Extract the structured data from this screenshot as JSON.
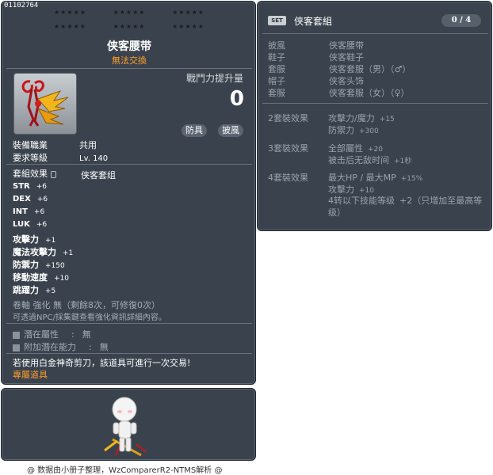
{
  "item": {
    "id": "01102764",
    "star_groups": [
      "★★★★★",
      "★★★★★",
      "★★★★★",
      "★★★★★",
      "★★★★★",
      "★★★★★"
    ],
    "name": "侠客腰带",
    "trade_status": "無法交換",
    "battle_power_label": "戰鬥力提升量",
    "battle_power_value": "0",
    "tags": [
      "防具",
      "披風"
    ],
    "requirements": [
      {
        "label": "裝備職業",
        "value": "共用"
      },
      {
        "label": "要求等級",
        "value": "Lv. 140"
      }
    ],
    "set_effect_label": "套組效果",
    "set_effect_name": "侠客套组",
    "stats": [
      {
        "label": "STR",
        "value": "+6"
      },
      {
        "label": "DEX",
        "value": "+6"
      },
      {
        "label": "INT",
        "value": "+6"
      },
      {
        "label": "LUK",
        "value": "+6"
      },
      {
        "label": "攻擊力",
        "value": "+1"
      },
      {
        "label": "魔法攻擊力",
        "value": "+1"
      },
      {
        "label": "防禦力",
        "value": "+150"
      },
      {
        "label": "移動速度",
        "value": "+10"
      },
      {
        "label": "跳躍力",
        "value": "+5"
      }
    ],
    "scroll_info": "卷軸 強化 無（剩餘8次，可修復0次）",
    "npc_info": "可透過NPC/採集鍵查看強化資訊詳細內容。",
    "potential": [
      {
        "label": "潛在屬性",
        "value": "無"
      },
      {
        "label": "附加潛在能力",
        "value": "無"
      }
    ],
    "scissors_note": "若使用白金神奇剪刀，該道具可進行一次交易!",
    "exclusive": "專屬道具"
  },
  "set": {
    "badge": "SET",
    "name": "侠客套組",
    "count": "0 / 4",
    "pieces": [
      {
        "slot": "披風",
        "name": "侠客腰带"
      },
      {
        "slot": "鞋子",
        "name": "侠客鞋子"
      },
      {
        "slot": "套服",
        "name": "侠客套服（男）（♂）"
      },
      {
        "slot": "帽子",
        "name": "侠客头饰"
      },
      {
        "slot": "套服",
        "name": "侠客套服（女）（♀）"
      }
    ],
    "bonuses": [
      {
        "label": "2套裝效果",
        "lines": [
          {
            "text": "攻擊力/魔力",
            "num": "+15"
          },
          {
            "text": "防禦力",
            "num": "+300"
          }
        ]
      },
      {
        "label": "3套裝效果",
        "lines": [
          {
            "text": "全部屬性",
            "num": "+20"
          },
          {
            "text": "被击后无敌时间",
            "num": "+1秒"
          }
        ]
      },
      {
        "label": "4套裝效果",
        "lines": [
          {
            "text": "最大HP / 最大MP",
            "num": "+15%"
          },
          {
            "text": "攻擊力",
            "num": "+10"
          },
          {
            "text": "4转以下技能等级",
            "num": "+2（只增加至最高等级）"
          }
        ]
      }
    ]
  },
  "footer": "@ 数据由小册子整理，WzComparerR2-NTMS解析 @",
  "colors": {
    "panel_bg": "#3a434d",
    "accent_orange": "#ff9d2a",
    "grey_text": "#a4adb6"
  }
}
